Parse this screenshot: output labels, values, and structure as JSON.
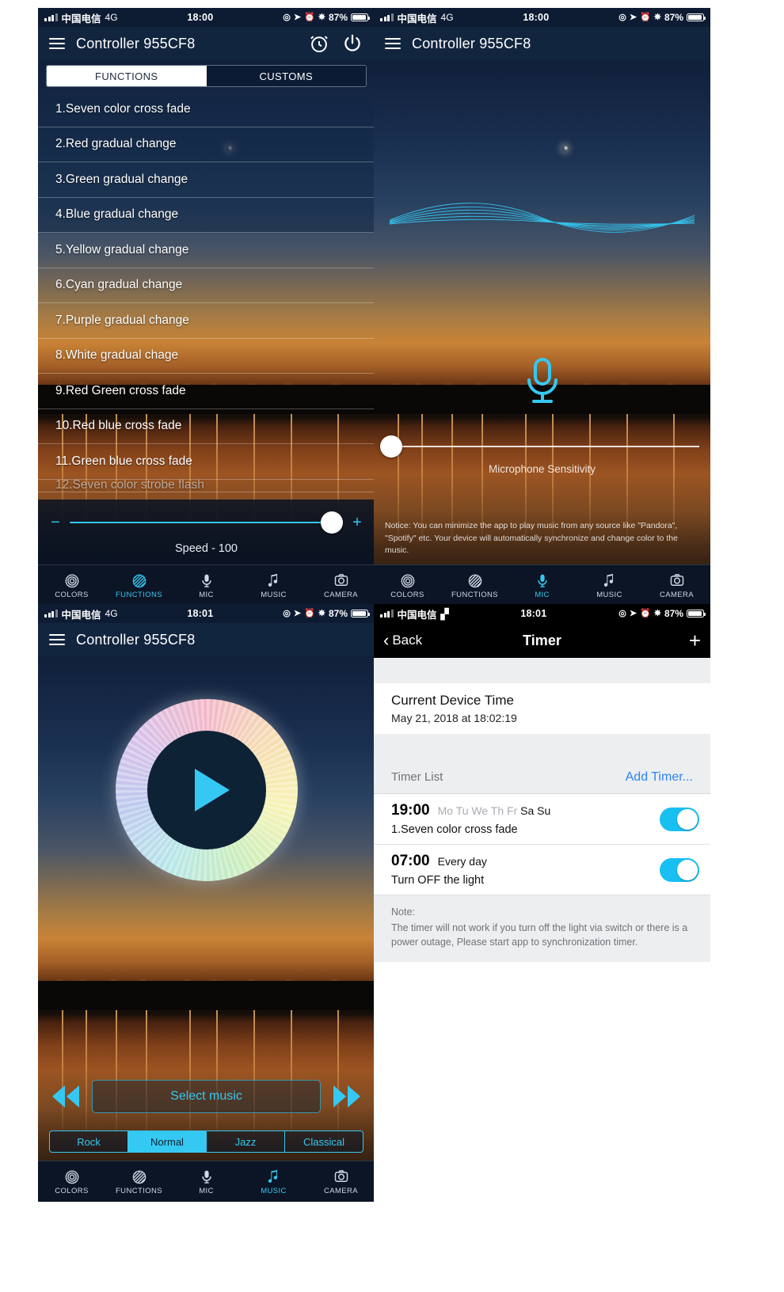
{
  "status_bar": {
    "carrier": "中国电信",
    "network_4g": "4G",
    "network_wifi": "wifi-icon",
    "time_1800": "18:00",
    "time_1801": "18:01",
    "battery_percent": "87%"
  },
  "app": {
    "title": "Controller 955CF8",
    "menu_icon": "list-menu-icon",
    "alarm_icon": "alarm-clock-icon",
    "power_icon": "power-icon"
  },
  "functions_screen": {
    "tabs": [
      {
        "label": "FUNCTIONS",
        "active": true
      },
      {
        "label": "CUSTOMS",
        "active": false
      }
    ],
    "items": [
      "1.Seven color cross fade",
      "2.Red gradual change",
      "3.Green gradual change",
      "4.Blue gradual change",
      "5.Yellow gradual change",
      "6.Cyan gradual change",
      "7.Purple gradual change",
      "8.White gradual chage",
      "9.Red Green cross fade",
      "10.Red blue cross fade",
      "11.Green blue cross fade"
    ],
    "partial_item": "12.Seven color strobe flash",
    "slider": {
      "minus": "−",
      "plus": "+",
      "label": "Speed - 100",
      "value": 100,
      "position_percent": 96
    }
  },
  "mic_screen": {
    "mic_icon": "microphone-icon",
    "sensitivity_label": "Microphone Sensitivity",
    "sensitivity_position_percent": 2,
    "notice": "Notice: You can minimize the app to play music from any source like \"Pandora\", \"Spotify\" etc. Your device will automatically synchronize and change color to the music."
  },
  "music_screen": {
    "play_icon": "play-icon",
    "prev_icon": "rewind-icon",
    "next_icon": "fast-forward-icon",
    "select_music_label": "Select music",
    "modes": [
      {
        "label": "Rock",
        "active": false
      },
      {
        "label": "Normal",
        "active": true
      },
      {
        "label": "Jazz",
        "active": false
      },
      {
        "label": "Classical",
        "active": false
      }
    ]
  },
  "timer_screen": {
    "back_label": "Back",
    "title": "Timer",
    "add_icon": "plus-icon",
    "current_device_time_label": "Current Device Time",
    "current_device_time_value": "May 21, 2018 at 18:02:19",
    "list_header": "Timer List",
    "add_timer_label": "Add Timer...",
    "timers": [
      {
        "time": "19:00",
        "days_off": "Mo Tu We Th Fr",
        "days_on": "Sa Su",
        "description": "1.Seven color cross fade",
        "enabled": true
      },
      {
        "time": "07:00",
        "days_off": "",
        "days_on": "Every day",
        "description": "Turn OFF the light",
        "enabled": true
      }
    ],
    "note_title": "Note:",
    "note_body": "The timer will not work if you turn off the light via switch or there is a power outage, Please start app to synchronization timer."
  },
  "tabbar": {
    "items": [
      {
        "label": "COLORS",
        "icon": "color-wheel-icon"
      },
      {
        "label": "FUNCTIONS",
        "icon": "striped-circle-icon"
      },
      {
        "label": "MIC",
        "icon": "microphone-icon"
      },
      {
        "label": "MUSIC",
        "icon": "music-note-icon"
      },
      {
        "label": "CAMERA",
        "icon": "camera-icon"
      }
    ],
    "active_functions": "FUNCTIONS",
    "active_mic": "MIC",
    "active_music": "MUSIC"
  },
  "colors": {
    "accent_cyan": "#35c8f2",
    "toggle_on": "#18c0f2",
    "link_blue": "#2f84f7",
    "navbar_dark": "#12253f"
  }
}
